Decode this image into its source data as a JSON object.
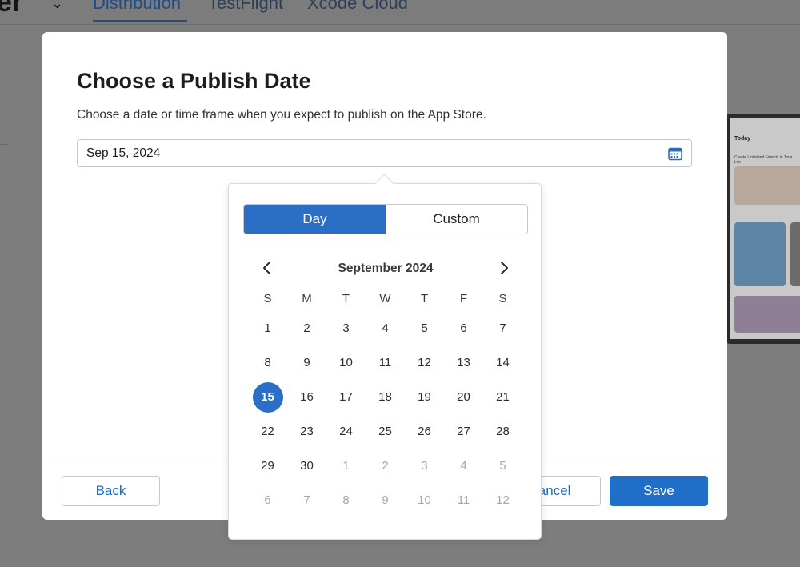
{
  "background": {
    "app_logo_fragment": "er",
    "tabs": [
      "Distribution",
      "TestFlight",
      "Xcode Cloud"
    ],
    "preview_today": "Today",
    "preview_headline": "Create Unlimited Friends in Toca Life"
  },
  "modal": {
    "title": "Choose a Publish Date",
    "description": "Choose a date or time frame when you expect to publish on the App Store.",
    "date_value": "Sep 15, 2024",
    "buttons": {
      "back": "Back",
      "cancel": "Cancel",
      "save": "Save"
    }
  },
  "picker": {
    "segments": {
      "day": "Day",
      "custom": "Custom"
    },
    "active_segment": "Day",
    "month_label": "September 2024",
    "weekdays": [
      "S",
      "M",
      "T",
      "W",
      "T",
      "F",
      "S"
    ],
    "selected_day": "15",
    "weeks": [
      [
        "1",
        "2",
        "3",
        "4",
        "5",
        "6",
        "7"
      ],
      [
        "8",
        "9",
        "10",
        "11",
        "12",
        "13",
        "14"
      ],
      [
        "15",
        "16",
        "17",
        "18",
        "19",
        "20",
        "21"
      ],
      [
        "22",
        "23",
        "24",
        "25",
        "26",
        "27",
        "28"
      ],
      [
        "29",
        "30",
        "1",
        "2",
        "3",
        "4",
        "5"
      ],
      [
        "6",
        "7",
        "8",
        "9",
        "10",
        "11",
        "12"
      ]
    ],
    "outside_month_flags": [
      [
        false,
        false,
        false,
        false,
        false,
        false,
        false
      ],
      [
        false,
        false,
        false,
        false,
        false,
        false,
        false
      ],
      [
        false,
        false,
        false,
        false,
        false,
        false,
        false
      ],
      [
        false,
        false,
        false,
        false,
        false,
        false,
        false
      ],
      [
        false,
        false,
        true,
        true,
        true,
        true,
        true
      ],
      [
        true,
        true,
        true,
        true,
        true,
        true,
        true
      ]
    ]
  },
  "colors": {
    "accent": "#1f6fc9",
    "overlay_dim": "#7d7d7d",
    "muted_day": "#a6a6ab"
  },
  "icons": {
    "date_field": "calendar-icon",
    "prev": "chevron-left-icon",
    "next": "chevron-right-icon",
    "header": "chevron-down-icon"
  }
}
